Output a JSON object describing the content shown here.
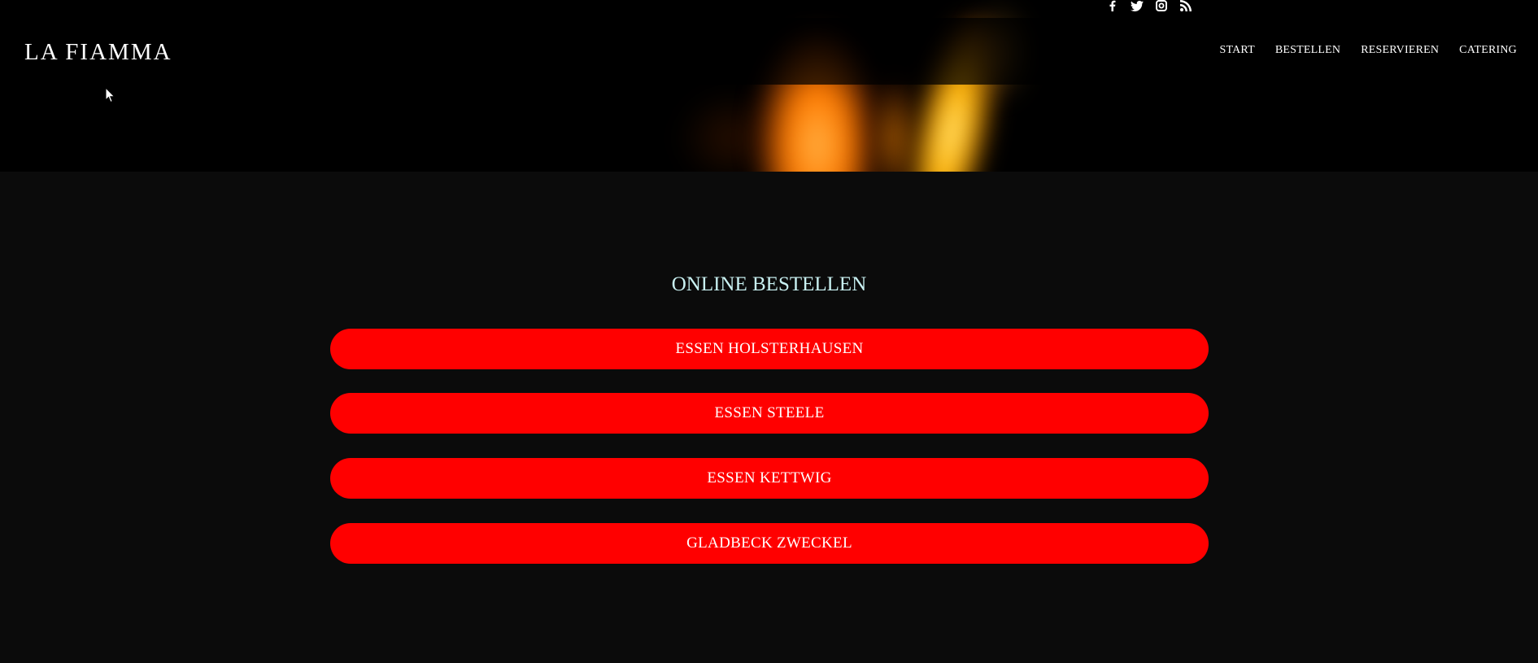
{
  "header": {
    "logo": "LA FIAMMA",
    "social_icons": [
      "facebook-icon",
      "twitter-icon",
      "instagram-icon",
      "rss-icon"
    ],
    "nav": [
      {
        "label": "START"
      },
      {
        "label": "BESTELLEN"
      },
      {
        "label": "RESERVIEREN"
      },
      {
        "label": "CATERING"
      }
    ]
  },
  "main": {
    "title": "ONLINE BESTELLEN",
    "buttons": [
      {
        "label": "ESSEN HOLSTERHAUSEN"
      },
      {
        "label": "ESSEN STEELE"
      },
      {
        "label": "ESSEN KETTWIG"
      },
      {
        "label": "GLADBECK ZWECKEL"
      }
    ]
  },
  "colors": {
    "button_bg": "#ff0000",
    "page_bg": "#0b0b0b",
    "title_color": "#c9f1f2"
  }
}
